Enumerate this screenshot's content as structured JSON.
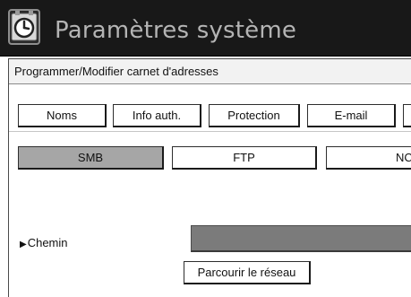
{
  "window": {
    "title": "Paramètres système",
    "icon": "clock-settings-icon"
  },
  "panel": {
    "heading": "Programmer/Modifier carnet d'adresses"
  },
  "tabs": [
    {
      "label": "Noms"
    },
    {
      "label": "Info auth."
    },
    {
      "label": "Protection"
    },
    {
      "label": "E-mail"
    }
  ],
  "protocols": [
    {
      "label": "SMB",
      "selected": true
    },
    {
      "label": "FTP",
      "selected": false
    },
    {
      "label": "NCP",
      "selected": false
    }
  ],
  "path": {
    "label": "Chemin",
    "value": ""
  },
  "browse_button": {
    "label": "Parcourir le réseau"
  },
  "colors": {
    "titlebar_bg": "#181818",
    "title_text": "#b4b4b4",
    "selected_button_bg": "#a6a6a6",
    "path_field_bg": "#7b7b7b"
  }
}
